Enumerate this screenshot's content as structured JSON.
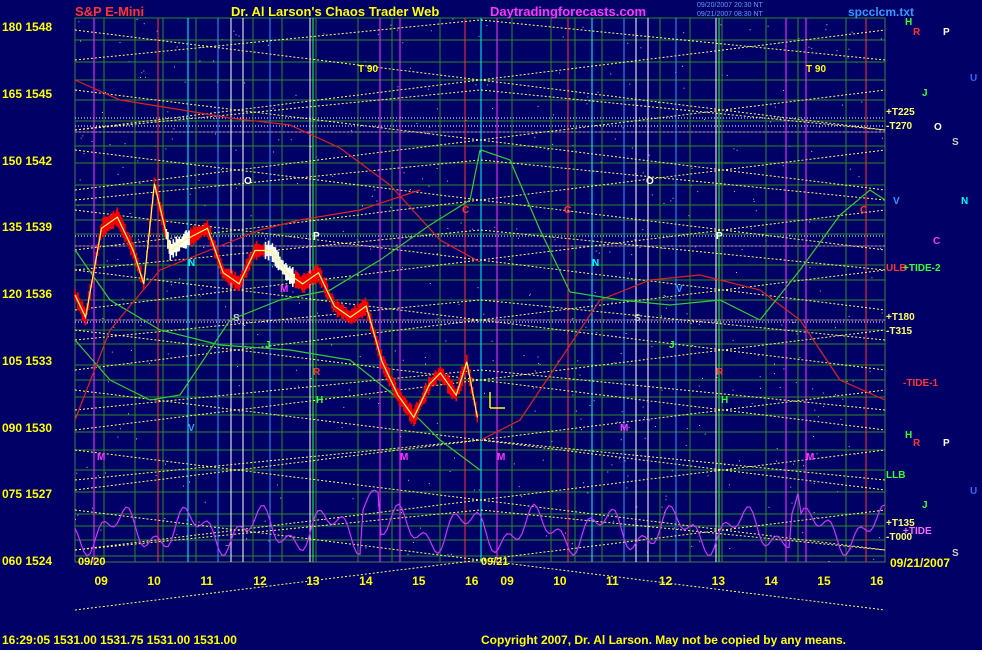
{
  "header": {
    "title_left": "S&P E-Mini",
    "title_center": "Dr. Al Larson's Chaos Trader Web",
    "site": "Daytradingforecasts.com",
    "timestamp_1": "09/20/2007 20:30 NT",
    "timestamp_2": "09/21/2007 08:30 NT",
    "file_name": "spcclcm.txt"
  },
  "footer": {
    "quote": "16:29:05  1531.00  1531.75  1531.00  1531.00",
    "copyright": "Copyright 2007, Dr. Al Larson. May not be copied by any means."
  },
  "axes": {
    "y_labels": [
      {
        "osc": "180",
        "price": "1548"
      },
      {
        "osc": "165",
        "price": "1545"
      },
      {
        "osc": "150",
        "price": "1542"
      },
      {
        "osc": "135",
        "price": "1539"
      },
      {
        "osc": "120",
        "price": "1536"
      },
      {
        "osc": "105",
        "price": "1533"
      },
      {
        "osc": "090",
        "price": "1530"
      },
      {
        "osc": "075",
        "price": "1527"
      },
      {
        "osc": "060",
        "price": "1524"
      }
    ],
    "x_labels_day1": [
      "09",
      "10",
      "11",
      "12",
      "13",
      "14",
      "15",
      "16"
    ],
    "x_labels_day2": [
      "09",
      "10",
      "11",
      "12",
      "13",
      "14",
      "15",
      "16"
    ],
    "date_day1": "09/20",
    "date_day2": "09/21",
    "date_end": "09/21/2007"
  },
  "chart_data": {
    "type": "line",
    "title": "S&P E-Mini",
    "ylim": [
      1524,
      1548
    ],
    "y2lim": [
      60,
      180
    ],
    "grid": true,
    "price_close_09_20": {
      "x_hours": [
        8.5,
        8.7,
        9.0,
        9.3,
        9.6,
        9.8,
        10.0,
        10.3,
        10.6,
        11.0,
        11.3,
        11.6,
        11.9,
        12.2,
        12.5,
        12.8,
        13.1,
        13.4,
        13.7,
        14.0,
        14.3,
        14.6,
        14.9,
        15.2,
        15.4,
        15.7,
        15.9,
        16.1
      ],
      "values": [
        1536,
        1535,
        1539,
        1539.5,
        1538,
        1536.5,
        1541,
        1538,
        1538.5,
        1539,
        1537,
        1536.5,
        1538,
        1538,
        1537,
        1536.5,
        1537,
        1535.5,
        1535,
        1535.5,
        1533,
        1531.5,
        1530.5,
        1532,
        1532.5,
        1531.5,
        1533,
        1530.5
      ]
    },
    "annotations": [
      {
        "text": "T 90",
        "color": "#ffff00"
      },
      {
        "text": "T 90",
        "color": "#ffff00"
      },
      {
        "text": "+T225",
        "color": "#ffff66"
      },
      {
        "text": "-T270",
        "color": "#ffff66"
      },
      {
        "text": "+T180",
        "color": "#ffff66"
      },
      {
        "text": "-T315",
        "color": "#ffff66"
      },
      {
        "text": "ULB",
        "color": "#ff3333"
      },
      {
        "text": "+TIDE-2",
        "color": "#33ff33"
      },
      {
        "text": "-TIDE-1",
        "color": "#ff3333"
      },
      {
        "text": "LLB",
        "color": "#33ff33"
      },
      {
        "text": "+T135",
        "color": "#ffff66"
      },
      {
        "text": "+TIDE",
        "color": "#ff66ff"
      },
      {
        "text": "-T000",
        "color": "#ffff66"
      }
    ],
    "planet_letters": [
      {
        "text": "H",
        "color": "#33ff33"
      },
      {
        "text": "R",
        "color": "#ff3333"
      },
      {
        "text": "P",
        "color": "#ffffff"
      },
      {
        "text": "U",
        "color": "#3366ff"
      },
      {
        "text": "J",
        "color": "#33ff33"
      },
      {
        "text": "O",
        "color": "#ffffff"
      },
      {
        "text": "S",
        "color": "#cccccc"
      },
      {
        "text": "V",
        "color": "#3399ff"
      },
      {
        "text": "N",
        "color": "#00ffff"
      },
      {
        "text": "C",
        "color": "#ff33ff"
      },
      {
        "text": "M",
        "color": "#ff33ff"
      },
      {
        "text": "H",
        "color": "#33ff33"
      },
      {
        "text": "R",
        "color": "#ff3333"
      },
      {
        "text": "P",
        "color": "#ffffff"
      },
      {
        "text": "U",
        "color": "#3366ff"
      },
      {
        "text": "J",
        "color": "#33ff33"
      },
      {
        "text": "S",
        "color": "#cccccc"
      },
      {
        "text": "O",
        "color": "#ffffff"
      },
      {
        "text": "P",
        "color": "#ffffff"
      },
      {
        "text": "N",
        "color": "#00ffff"
      },
      {
        "text": "S",
        "color": "#cccccc"
      },
      {
        "text": "J",
        "color": "#33ff33"
      },
      {
        "text": "R",
        "color": "#ff3333"
      },
      {
        "text": "H",
        "color": "#33ff33"
      },
      {
        "text": "M",
        "color": "#ff33ff"
      },
      {
        "text": "M",
        "color": "#ff33ff"
      },
      {
        "text": "V",
        "color": "#3399ff"
      },
      {
        "text": "M",
        "color": "#ff33ff"
      },
      {
        "text": "C",
        "color": "#ff3333"
      },
      {
        "text": "O",
        "color": "#ffffff"
      },
      {
        "text": "C",
        "color": "#ff3333"
      },
      {
        "text": "N",
        "color": "#00ffff"
      },
      {
        "text": "P",
        "color": "#ffffff"
      },
      {
        "text": "S",
        "color": "#cccccc"
      },
      {
        "text": "R",
        "color": "#ff3333"
      },
      {
        "text": "H",
        "color": "#33ff33"
      },
      {
        "text": "M",
        "color": "#ff33ff"
      },
      {
        "text": "J",
        "color": "#33ff33"
      },
      {
        "text": "V",
        "color": "#3399ff"
      },
      {
        "text": "M",
        "color": "#ff33ff"
      },
      {
        "text": "C",
        "color": "#ff3333"
      }
    ]
  },
  "colors": {
    "background": "#000066",
    "grid_line": "#2a8a2a",
    "price_bar": "#ff0000",
    "price_bar_highlight": "#ffffff",
    "field_line_yellow": "#ffff66",
    "oscillator_magenta": "#cc33ff",
    "green_line": "#33cc33",
    "red_line": "#dd2222",
    "site_link": "#ff33ff"
  }
}
